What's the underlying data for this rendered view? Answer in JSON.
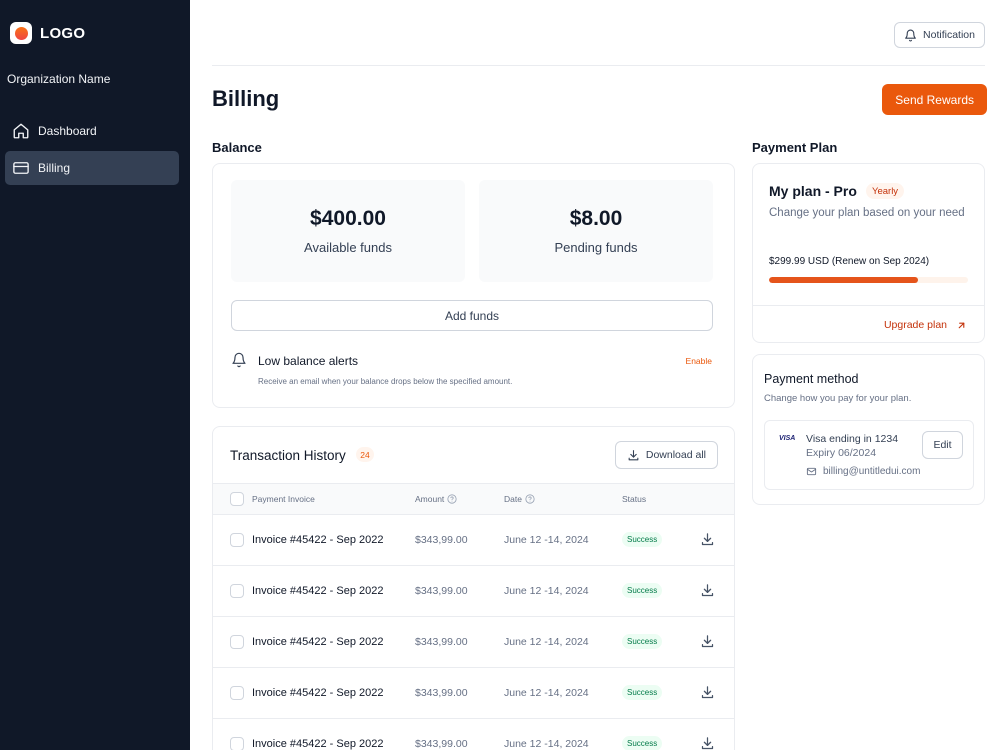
{
  "sidebar": {
    "logo_text": "LOGO",
    "org_name": "Organization Name",
    "items": [
      {
        "label": "Dashboard",
        "icon": "home-icon",
        "active": false
      },
      {
        "label": "Billing",
        "icon": "credit-card-icon",
        "active": true
      }
    ]
  },
  "header": {
    "notification_label": "Notification",
    "title": "Billing",
    "send_rewards_label": "Send Rewards"
  },
  "balance": {
    "section_title": "Balance",
    "available_amount": "$400.00",
    "available_label": "Available funds",
    "pending_amount": "$8.00",
    "pending_label": "Pending funds",
    "add_funds_label": "Add funds",
    "alert_title": "Low balance alerts",
    "alert_description": "Receive an email when your balance drops below the specified amount.",
    "alert_action": "Enable"
  },
  "transactions": {
    "title": "Transaction History",
    "count": "24",
    "download_all_label": "Download all",
    "columns": {
      "invoice": "Payment Invoice",
      "amount": "Amount",
      "date": "Date",
      "status": "Status"
    },
    "rows": [
      {
        "invoice": "Invoice #45422 - Sep 2022",
        "amount": "$343,99.00",
        "date": "June 12 -14, 2024",
        "status": "Success"
      },
      {
        "invoice": "Invoice #45422 - Sep 2022",
        "amount": "$343,99.00",
        "date": "June 12 -14, 2024",
        "status": "Success"
      },
      {
        "invoice": "Invoice #45422 - Sep 2022",
        "amount": "$343,99.00",
        "date": "June 12 -14, 2024",
        "status": "Success"
      },
      {
        "invoice": "Invoice #45422 - Sep 2022",
        "amount": "$343,99.00",
        "date": "June 12 -14, 2024",
        "status": "Success"
      },
      {
        "invoice": "Invoice #45422 - Sep 2022",
        "amount": "$343,99.00",
        "date": "June 12 -14, 2024",
        "status": "Success"
      }
    ]
  },
  "plan": {
    "section_title": "Payment Plan",
    "name": "My plan - Pro",
    "badge": "Yearly",
    "description": "Change your plan based on your need",
    "price": "$299.99 USD (Renew on Sep 2024)",
    "progress_fraction": 0.75,
    "upgrade_label": "Upgrade plan"
  },
  "payment_method": {
    "title": "Payment method",
    "description": "Change how you pay for your plan.",
    "card_brand": "VISA",
    "card_label": "Visa ending in 1234",
    "expiry": "Expiry 06/2024",
    "email": "billing@untitledui.com",
    "edit_label": "Edit"
  },
  "colors": {
    "accent": "#ea580c",
    "sidebar_bg": "#101828",
    "success_bg": "#ecfdf3",
    "success_text": "#027a48"
  }
}
